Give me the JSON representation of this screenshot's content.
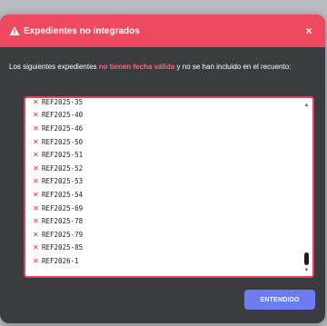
{
  "modal": {
    "title": "Expedientes no integrados",
    "close_label": "×",
    "message_before": "Los siguientes expedientes ",
    "message_highlight": "no tienen fecha válida",
    "message_after": " y no se han incluido en el recuento:",
    "confirm_label": "ENTENDIDO"
  },
  "colors": {
    "header": "#f0485e",
    "highlight": "#f36a7c",
    "list_border": "#ea3f56",
    "button": "#6c7cf0"
  },
  "icons": {
    "title": "warning-triangle-icon",
    "item": "x-mark-icon"
  },
  "list": {
    "items": [
      "REF2025-35",
      "REF2025-40",
      "REF2025-46",
      "REF2025-50",
      "REF2025-51",
      "REF2025-52",
      "REF2025-53",
      "REF2025-54",
      "REF2025-69",
      "REF2025-78",
      "REF2025-79",
      "REF2025-85",
      "REF2026-1"
    ]
  }
}
